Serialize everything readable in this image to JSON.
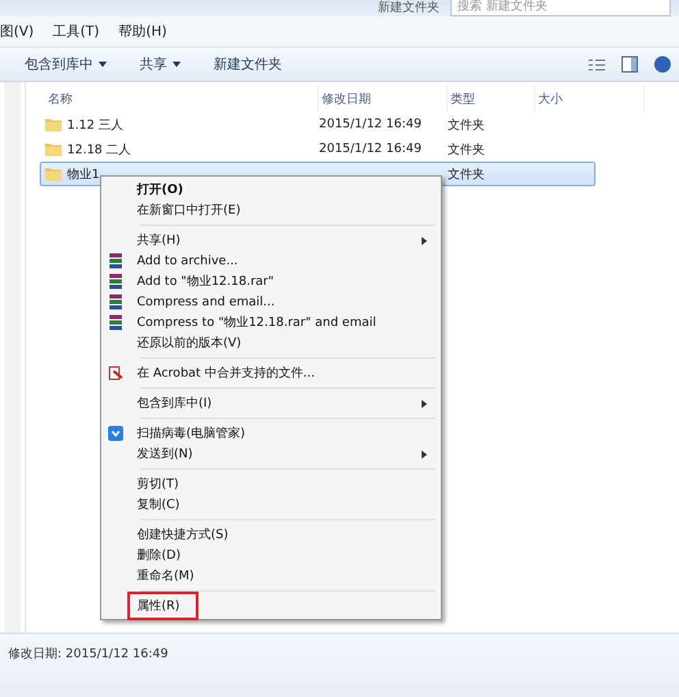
{
  "address_bar": {
    "crumbs": [
      "新建文件夹"
    ],
    "search": {
      "placeholder": "搜索 新建文件夹"
    }
  },
  "menu_bar": [
    "图(V)",
    "工具(T)",
    "帮助(H)"
  ],
  "toolbar": {
    "buttons": [
      {
        "label": "包含到库中",
        "dropdown": true
      },
      {
        "label": "共享",
        "dropdown": true
      },
      {
        "label": "新建文件夹",
        "dropdown": false
      }
    ]
  },
  "table": {
    "columns": [
      "名称",
      "修改日期",
      "类型",
      "大小"
    ],
    "rows": [
      {
        "name": "1.12 三人",
        "date": "2015/1/12 16:49",
        "type": "文件夹",
        "selected": false
      },
      {
        "name": "12.18 二人",
        "date": "2015/1/12 16:49",
        "type": "文件夹",
        "selected": false
      },
      {
        "name": "物业1",
        "date": "",
        "type": "文件夹",
        "selected": true
      }
    ]
  },
  "context_menu": [
    {
      "kind": "item",
      "label": "打开(O)",
      "bold": true,
      "submenu": false,
      "highlighted": false
    },
    {
      "kind": "item",
      "label": "在新窗口中打开(E)",
      "bold": false,
      "submenu": false,
      "highlighted": false
    },
    {
      "kind": "separator"
    },
    {
      "kind": "item",
      "label": "共享(H)",
      "bold": false,
      "submenu": true,
      "highlighted": false
    },
    {
      "kind": "archive",
      "label": "Add to archive...",
      "bold": false,
      "submenu": false,
      "highlighted": false
    },
    {
      "kind": "archive",
      "label": "Add to \"物业12.18.rar\"",
      "bold": false,
      "submenu": false,
      "highlighted": false
    },
    {
      "kind": "archive",
      "label": "Compress and email...",
      "bold": false,
      "submenu": false,
      "highlighted": false
    },
    {
      "kind": "archive",
      "label": "Compress to \"物业12.18.rar\" and email",
      "bold": false,
      "submenu": false,
      "highlighted": false
    },
    {
      "kind": "item",
      "label": "还原以前的版本(V)",
      "bold": false,
      "submenu": false,
      "highlighted": false
    },
    {
      "kind": "separator"
    },
    {
      "kind": "acrobat",
      "label": "在 Acrobat 中合并支持的文件...",
      "bold": false,
      "submenu": false,
      "highlighted": false
    },
    {
      "kind": "separator"
    },
    {
      "kind": "item",
      "label": "包含到库中(I)",
      "bold": false,
      "submenu": true,
      "highlighted": false
    },
    {
      "kind": "separator"
    },
    {
      "kind": "scan",
      "label": "扫描病毒(电脑管家)",
      "bold": false,
      "submenu": false,
      "highlighted": false
    },
    {
      "kind": "item",
      "label": "发送到(N)",
      "bold": false,
      "submenu": true,
      "highlighted": false
    },
    {
      "kind": "separator"
    },
    {
      "kind": "item",
      "label": "剪切(T)",
      "bold": false,
      "submenu": false,
      "highlighted": false
    },
    {
      "kind": "item",
      "label": "复制(C)",
      "bold": false,
      "submenu": false,
      "highlighted": false
    },
    {
      "kind": "separator"
    },
    {
      "kind": "item",
      "label": "创建快捷方式(S)",
      "bold": false,
      "submenu": false,
      "highlighted": false
    },
    {
      "kind": "item",
      "label": "删除(D)",
      "bold": false,
      "submenu": false,
      "highlighted": false
    },
    {
      "kind": "item",
      "label": "重命名(M)",
      "bold": false,
      "submenu": false,
      "highlighted": false
    },
    {
      "kind": "separator"
    },
    {
      "kind": "item",
      "label": "属性(R)",
      "bold": false,
      "submenu": false,
      "highlighted": true
    }
  ],
  "status_bar": {
    "text": "修改日期: 2015/1/12 16:49"
  }
}
